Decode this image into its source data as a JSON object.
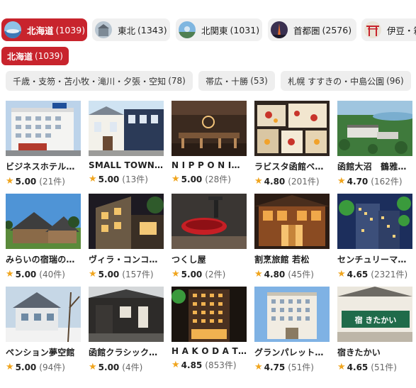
{
  "areas": [
    {
      "label": "北海道",
      "count": "(1039)",
      "active": true,
      "icon": "hokkaido-area-icon"
    },
    {
      "label": "東北",
      "count": "(1343)",
      "active": false,
      "icon": "tohoku-area-icon"
    },
    {
      "label": "北関東",
      "count": "(1031)",
      "active": false,
      "icon": "kitakanto-area-icon"
    },
    {
      "label": "首都圏",
      "count": "(2576)",
      "active": false,
      "icon": "shutoken-area-icon"
    },
    {
      "label": "伊豆・箱",
      "count": "",
      "active": false,
      "icon": "izu-area-icon"
    }
  ],
  "selected": {
    "label": "北海道",
    "count": "(1039)"
  },
  "subareas": [
    {
      "label": "千歳・支笏・苫小牧・滝川・夕張・空知",
      "count": "(78)"
    },
    {
      "label": "帯広・十勝",
      "count": "(53)"
    },
    {
      "label": "札幌 すすきの・中島公園",
      "count": "(96)"
    }
  ],
  "colors": {
    "accent": "#c8242d",
    "star": "#f0a51e"
  },
  "hotels": [
    {
      "name": "ビジネスホテル…",
      "score": "5.00",
      "reviews": "(21件)"
    },
    {
      "name": "SMALL TOWN…",
      "score": "5.00",
      "reviews": "(13件)"
    },
    {
      "name": "N I P P O N I…",
      "score": "5.00",
      "reviews": "(28件)"
    },
    {
      "name": "ラビスタ函館ベ…",
      "score": "4.80",
      "reviews": "(201件)"
    },
    {
      "name": "函館大沼　鶴雅…",
      "score": "4.70",
      "reviews": "(162件)"
    },
    {
      "name": "みらいの宿瑞の…",
      "score": "5.00",
      "reviews": "(40件)"
    },
    {
      "name": "ヴィラ・コンコ…",
      "score": "5.00",
      "reviews": "(157件)"
    },
    {
      "name": "つくし屋",
      "score": "5.00",
      "reviews": "(2件)"
    },
    {
      "name": "割烹旅館 若松",
      "score": "4.80",
      "reviews": "(45件)"
    },
    {
      "name": "センチュリーマ…",
      "score": "4.65",
      "reviews": "(2321件)"
    },
    {
      "name": "ペンション夢空館",
      "score": "5.00",
      "reviews": "(94件)"
    },
    {
      "name": "函館クラシック…",
      "score": "5.00",
      "reviews": "(4件)"
    },
    {
      "name": "H A K O D A T…",
      "score": "4.85",
      "reviews": "(853件)"
    },
    {
      "name": "グランパレット…",
      "score": "4.75",
      "reviews": "(51件)"
    },
    {
      "name": "宿きたかい",
      "score": "4.65",
      "reviews": "(51件)"
    }
  ],
  "photo_texts": {
    "kitakai_sign": "宿 きたかい"
  }
}
